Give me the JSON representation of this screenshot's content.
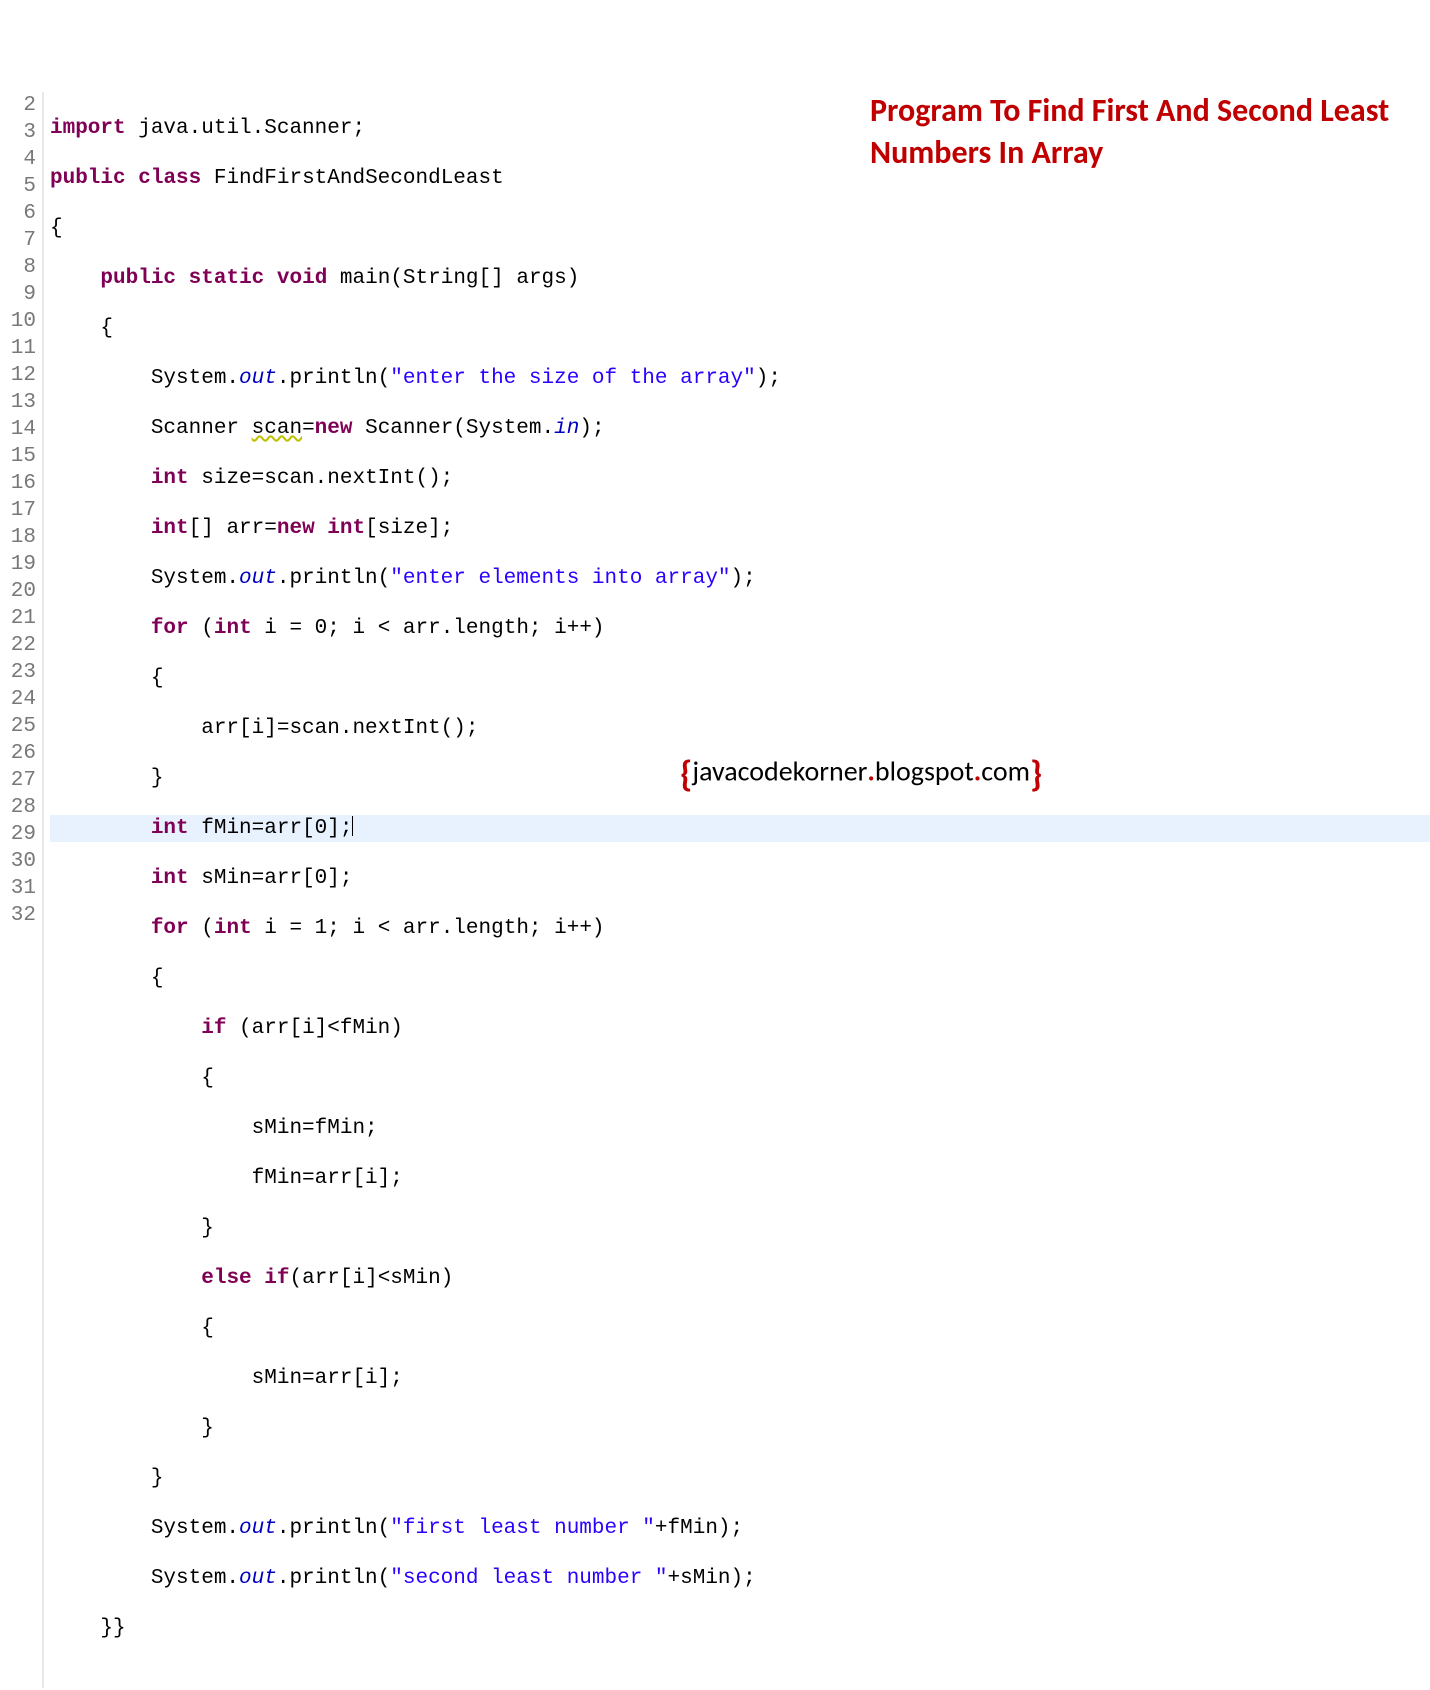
{
  "title_overlay": "Program To Find First And Second Least Numbers In Array",
  "footer": {
    "open": "{",
    "text1": "javacodekorner",
    "text2": "blogspot",
    "text3": "com",
    "close": "}"
  },
  "gutter_start": 2,
  "gutter_end": 32,
  "code": {
    "l2": {
      "kw1": "import",
      "t1": " java.util.Scanner;"
    },
    "l3": {
      "kw1": "public",
      "kw2": "class",
      "t1": " FindFirstAndSecondLeast"
    },
    "l4": {
      "t1": "{"
    },
    "l5": {
      "kw1": "public",
      "kw2": "static",
      "kw3": "void",
      "t1": " main(String[] args)"
    },
    "l6": {
      "t1": "    {"
    },
    "l7": {
      "t1": "        System.",
      "f1": "out",
      "t2": ".println(",
      "s1": "\"enter the size of the array\"",
      "t3": ");"
    },
    "l8": {
      "t1": "        Scanner ",
      "u1": "scan",
      "t2": "=",
      "kw1": "new",
      "t3": " Scanner(System.",
      "f1": "in",
      "t4": ");"
    },
    "l9": {
      "t1": "        ",
      "kw1": "int",
      "t2": " size=scan.nextInt();"
    },
    "l10": {
      "t1": "        ",
      "kw1": "int",
      "t2": "[] arr=",
      "kw2": "new",
      "t3": " ",
      "kw3": "int",
      "t4": "[size];"
    },
    "l11": {
      "t1": "        System.",
      "f1": "out",
      "t2": ".println(",
      "s1": "\"enter elements into array\"",
      "t3": ");"
    },
    "l12": {
      "t1": "        ",
      "kw1": "for",
      "t2": " (",
      "kw2": "int",
      "t3": " i = 0; i < arr.length; i++)"
    },
    "l13": {
      "t1": "        {"
    },
    "l14": {
      "t1": "            arr[i]=scan.nextInt();"
    },
    "l15": {
      "t1": "        }"
    },
    "l16": {
      "t1": "        ",
      "kw1": "int",
      "t2": " fMin=arr[0];"
    },
    "l17": {
      "t1": "        ",
      "kw1": "int",
      "t2": " sMin=arr[0];"
    },
    "l18": {
      "t1": "        ",
      "kw1": "for",
      "t2": " (",
      "kw2": "int",
      "t3": " i = 1; i < arr.length; i++)"
    },
    "l19": {
      "t1": "        {"
    },
    "l20": {
      "t1": "            ",
      "kw1": "if",
      "t2": " (arr[i]<fMin)"
    },
    "l21": {
      "t1": "            {"
    },
    "l22": {
      "t1": "                sMin=fMin;"
    },
    "l23": {
      "t1": "                fMin=arr[i];"
    },
    "l24": {
      "t1": "            }"
    },
    "l25": {
      "t1": "            ",
      "kw1": "else",
      "t2": " ",
      "kw2": "if",
      "t3": "(arr[i]<sMin)"
    },
    "l26": {
      "t1": "            {"
    },
    "l27": {
      "t1": "                sMin=arr[i];"
    },
    "l28": {
      "t1": "            }"
    },
    "l29": {
      "t1": "        }"
    },
    "l30": {
      "t1": "        System.",
      "f1": "out",
      "t2": ".println(",
      "s1": "\"first least number \"",
      "t3": "+fMin);"
    },
    "l31": {
      "t1": "        System.",
      "f1": "out",
      "t2": ".println(",
      "s1": "\"second least number \"",
      "t3": "+sMin);"
    },
    "l32": {
      "t1": "    }}"
    }
  }
}
